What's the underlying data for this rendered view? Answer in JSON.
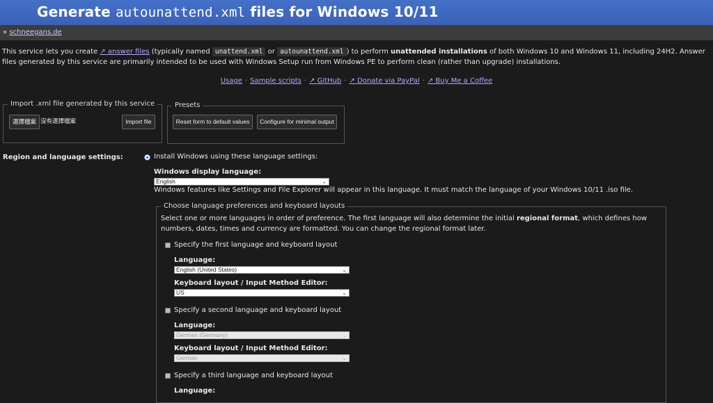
{
  "header": {
    "title_pre": "Generate ",
    "title_mono": "autounattend.xml",
    "title_post": " files for Windows 10/11"
  },
  "breadcrumb": {
    "prefix": "»",
    "link": "schneegans.de"
  },
  "intro": {
    "t1": "This service lets you create ",
    "answer_files": "↗ answer files",
    "t2": " (typically named ",
    "code1": "unattend.xml",
    "t3": " or ",
    "code2": "autounattend.xml",
    "t4": ") to perform ",
    "bold1": "unattended installations",
    "t5": " of both Windows 10 and Windows 11, including 24H2. Answer files generated by this service are primarily intended to be used with Windows Setup run from Windows PE to perform clean (rather than upgrade) installations."
  },
  "links": [
    "Usage",
    "Sample scripts",
    "↗ GitHub",
    "↗ Donate via PayPal",
    "↗ Buy Me a Coffee"
  ],
  "import": {
    "legend": "Import .xml file generated by this service",
    "choose": "選擇檔案",
    "nofile": "沒有選擇檔案",
    "import_btn": "Import file"
  },
  "presets": {
    "legend": "Presets",
    "reset": "Reset form to default values",
    "minimal": "Configure for minimal output"
  },
  "region": {
    "section_label": "Region and language settings:",
    "radio_label": "Install Windows using these language settings:",
    "display_lang_label": "Windows display language:",
    "display_lang_value": "English",
    "display_lang_hint": "Windows features like Settings and File Explorer will appear in this language. It must match the language of your Windows 10/11 .iso file.",
    "prefs_legend": "Choose language preferences and keyboard layouts",
    "prefs_t1": "Select one or more languages in order of preference. The first language will also determine the initial ",
    "prefs_bold": "regional format",
    "prefs_t2": ", which defines how numbers, dates, times and currency are formatted. You can change the regional format later.",
    "first": {
      "check_label": "Specify the first language and keyboard layout",
      "lang_label": "Language:",
      "lang_value": "English (United States)",
      "kb_label": "Keyboard layout / Input Method Editor:",
      "kb_value": "US"
    },
    "second": {
      "check_label": "Specify a second language and keyboard layout",
      "lang_label": "Language:",
      "lang_value": "German (Germany)",
      "kb_label": "Keyboard layout / Input Method Editor:",
      "kb_value": "German"
    },
    "third": {
      "check_label": "Specify a third language and keyboard layout",
      "lang_label": "Language:"
    }
  },
  "colors": {
    "header_bg": "#3a62b8",
    "page_bg": "#1b1b1b",
    "link": "#b9a6ff"
  }
}
